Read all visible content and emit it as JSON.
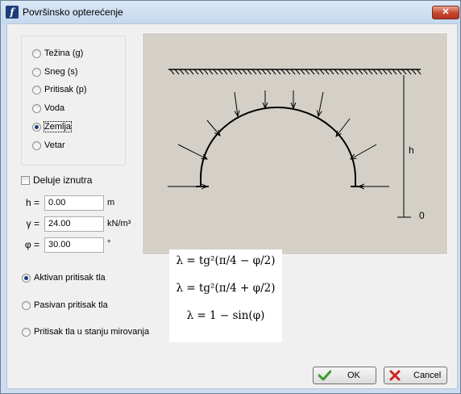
{
  "window": {
    "title": "Površinsko opterećenje",
    "close_glyph": "✕"
  },
  "load_type": {
    "options": [
      {
        "label": "Težina (g)",
        "selected": false
      },
      {
        "label": "Sneg (s)",
        "selected": false
      },
      {
        "label": "Pritisak (p)",
        "selected": false
      },
      {
        "label": "Voda",
        "selected": false
      },
      {
        "label": "Zemlja",
        "selected": true
      },
      {
        "label": "Vetar",
        "selected": false
      }
    ]
  },
  "acts_inside": {
    "label": "Deluje iznutra",
    "checked": false
  },
  "fields": {
    "h": {
      "label": "h =",
      "value": "0.00",
      "unit": "m"
    },
    "gamma": {
      "label": "γ =",
      "value": "24.00",
      "unit": "kN/m³"
    },
    "phi": {
      "label": "φ =",
      "value": "30.00",
      "unit": "°"
    }
  },
  "pressure_type": {
    "options": [
      {
        "label": "Aktivan pritisak tla",
        "selected": true
      },
      {
        "label": "Pasivan pritisak tla",
        "selected": false
      },
      {
        "label": "Pritisak tla u stanju mirovanja",
        "selected": false
      }
    ]
  },
  "formulas": {
    "active": "λ = tg²(π/4 − φ/2)",
    "passive": "λ = tg²(π/4 + φ/2)",
    "rest": "λ = 1 − sin(φ)"
  },
  "diagram": {
    "h_label": "h",
    "zero_label": "0"
  },
  "buttons": {
    "ok": "OK",
    "cancel": "Cancel"
  },
  "colors": {
    "titlebar": "#c4d8ee",
    "diagram_bg": "#d4d0c8",
    "ok_icon": "#3a9c2e",
    "cancel_icon": "#d02222"
  }
}
